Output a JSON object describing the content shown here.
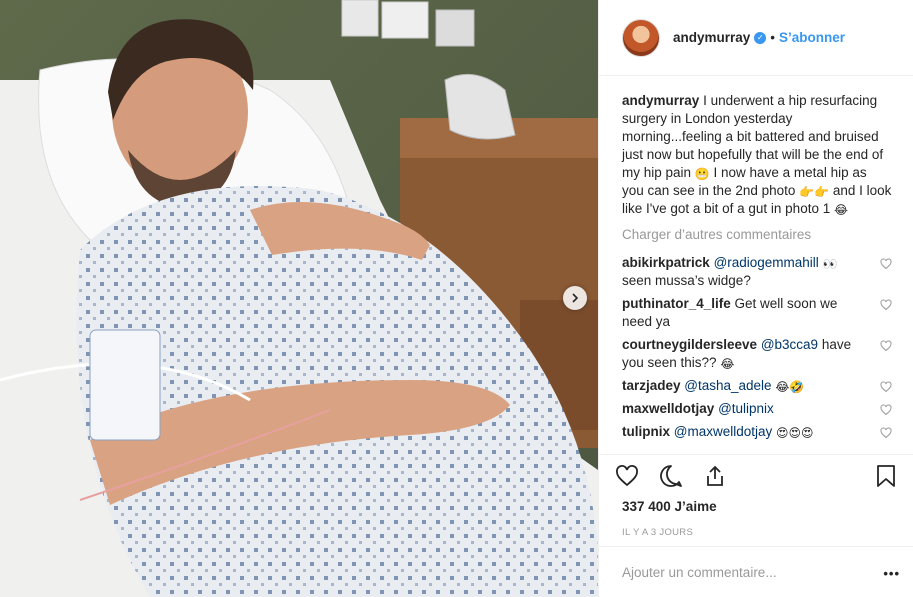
{
  "post": {
    "username": "andymurray",
    "follow_label": "S’abonner",
    "dot": "•",
    "caption_username": "andymurray",
    "caption_text": "I underwent a hip resurfacing surgery in London yesterday morning...feeling a bit battered and bruised just now but hopefully that will be the end of my hip pain",
    "caption_text_2": "I now have a metal hip as you can see in the 2nd photo",
    "caption_text_3": "and I look like I've got a bit of a gut in photo 1",
    "emoji_grin": "😬",
    "emoji_point": "👉👉",
    "emoji_laugh": "😂",
    "load_more": "Charger d’autres commentaires",
    "comments": [
      {
        "user": "abikirkpatrick",
        "mention": "@radiogemmahill",
        "text": "seen mussa’s widge?",
        "emoji": "👀"
      },
      {
        "user": "puthinator_4_life",
        "text": "Get well soon we need ya"
      },
      {
        "user": "courtneygildersleeve",
        "mention": "@b3cca9",
        "text": "have you seen this??",
        "emoji": "😂"
      },
      {
        "user": "tarzjadey",
        "mention": "@tasha_adele",
        "emoji": "😂🤣"
      },
      {
        "user": "maxwelldotjay",
        "mention": "@tulipnix"
      },
      {
        "user": "tulipnix",
        "mention": "@maxwelldotjay",
        "emoji": "😍😍😍"
      }
    ],
    "likes": "337 400 J’aime",
    "time_ago": "IL Y A 3 JOURS",
    "add_comment_placeholder": "Ajouter un commentaire...",
    "more_options": "•••"
  },
  "icons": {
    "like": "heart-icon",
    "comment": "comment-icon",
    "share": "share-icon",
    "save": "bookmark-icon",
    "next": "chevron-right-icon"
  },
  "colors": {
    "link_blue": "#3897f0",
    "mention": "#003569",
    "muted": "#999999"
  }
}
